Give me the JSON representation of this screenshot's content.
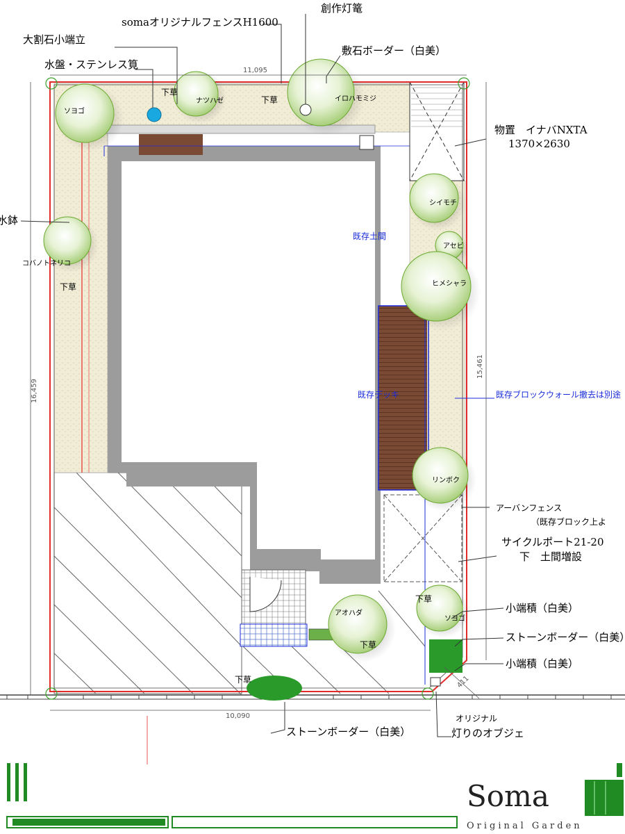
{
  "labels": {
    "fence": "somaオリジナルフェンスH1600",
    "lantern": "創作灯篭",
    "big_stone": "大割石小端立",
    "stone_border_top": "敷石ボーダー（白美）",
    "basin": "水盤・ステンレス筧",
    "shed": "物置　イナバNXTA",
    "shed_size": "1370×2630",
    "bowl": "水鉢",
    "urban_fence": "アーバンフェンス",
    "urban_fence_note": "（既存ブロック上よ",
    "cycle_port": "サイクルポート21-20",
    "cycle_port_note": "下　土間増設",
    "kobazumi_1": "小端積（白美）",
    "stone_border_right": "ストーンボーダー（白美）",
    "kobazumi_2": "小端積（白美）",
    "stone_border_bottom": "ストーンボーダー（白美）",
    "original_label": "オリジナル",
    "light_object": "灯りのオブジェ",
    "existing_doma": "既存土間",
    "existing_deck": "既存デッキ",
    "block_wall_note": "既存ブロックウォール撤去は別途",
    "shitakusa_1": "下草",
    "shitakusa_2": "下草",
    "shitakusa_3": "下草",
    "shitakusa_4": "下草",
    "shitakusa_5": "下草",
    "shitakusa_6": "下草",
    "soyogo_1": "ソヨゴ",
    "soyogo_2": "ソヨゴ",
    "natsuhaze": "ナツハゼ",
    "iroha": "イロハモミジ",
    "kono": "コバノトネリコ",
    "shiimochi": "シイモチ",
    "asebi": "アセビ",
    "himeshara": "ヒメシャラ",
    "ringo": "リンボク",
    "aohada": "アオハダ"
  },
  "dimensions": {
    "top": "11,095",
    "left": "16,459",
    "right": "15,461",
    "bottom": "10,090",
    "corner": "411"
  },
  "brand": {
    "name": "Soma",
    "tagline": "Original Garden"
  },
  "colors": {
    "boundary": "#e22b2b",
    "wall": "#9c9c9c",
    "deck": "#7a4a35",
    "blue": "#1a2bd8",
    "tree": "#7fbf3a",
    "gravel": "#eee8cf",
    "brand_green": "#1f8b22"
  }
}
